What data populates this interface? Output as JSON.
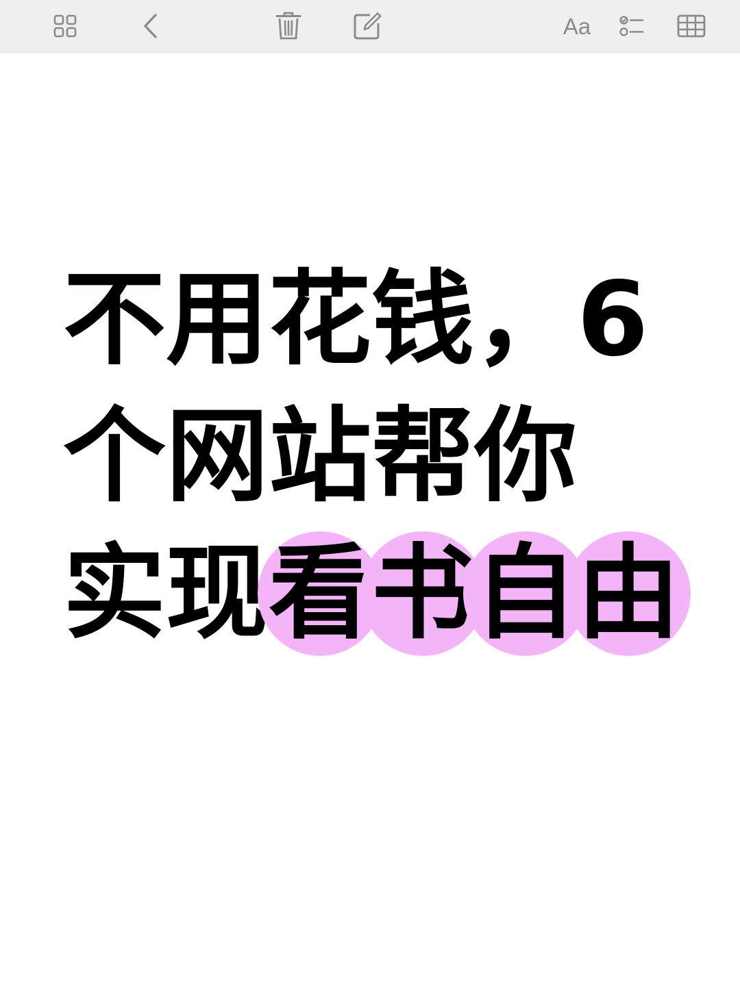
{
  "toolbar": {
    "icons": {
      "gallery": "gallery-grid-icon",
      "back": "chevron-left-icon",
      "delete": "trash-icon",
      "compose": "compose-icon",
      "format": "text-format-icon",
      "checklist": "checklist-icon",
      "table": "table-icon"
    },
    "format_label": "Aa",
    "icon_color": "#8b8b8b",
    "background": "#efefef"
  },
  "note": {
    "line1": "不用花钱，6",
    "line2": "个网站帮你",
    "line3_prefix": "实现",
    "highlight_chars": [
      "看",
      "书",
      "自",
      "由"
    ],
    "text_color": "#000000",
    "highlight_color": "#f3b5f8"
  }
}
